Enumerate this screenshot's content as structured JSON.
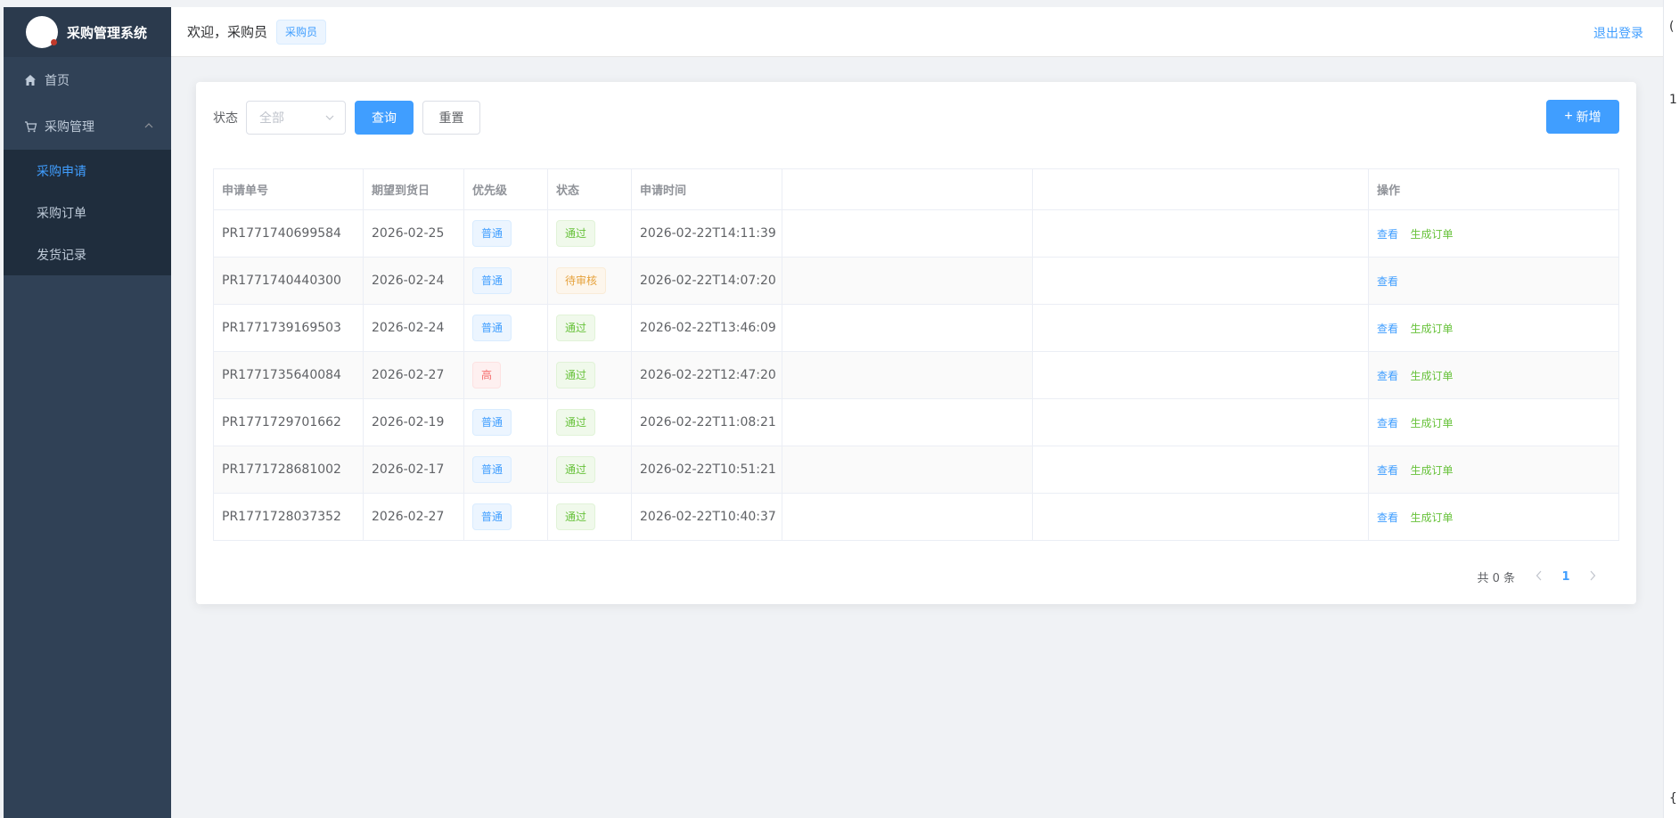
{
  "app": {
    "title": "采购管理系统"
  },
  "sidebar": {
    "items": [
      {
        "label": "首页",
        "icon": "home-icon"
      },
      {
        "label": "采购管理",
        "icon": "cart-icon",
        "expanded": true,
        "children": [
          {
            "label": "采购申请",
            "active": true
          },
          {
            "label": "采购订单"
          },
          {
            "label": "发货记录"
          }
        ]
      }
    ]
  },
  "header": {
    "welcome": "欢迎，采购员",
    "role": "采购员",
    "logout": "退出登录"
  },
  "filter": {
    "status_label": "状态",
    "status_placeholder": "全部",
    "query_label": "查询",
    "reset_label": "重置",
    "add_label": "新增"
  },
  "table": {
    "headers": {
      "request_no": "申请单号",
      "expected_date": "期望到货日",
      "priority": "优先级",
      "status": "状态",
      "request_time": "申请时间",
      "ops": "操作"
    },
    "rows": [
      {
        "request_no": "PR1771740699584",
        "expected_date": "2026-02-25",
        "priority": "普通",
        "status": "通过",
        "request_time": "2026-02-22T14:11:39",
        "view": "查看",
        "gen": "生成订单"
      },
      {
        "request_no": "PR1771740440300",
        "expected_date": "2026-02-24",
        "priority": "普通",
        "status": "待审核",
        "request_time": "2026-02-22T14:07:20",
        "view": "查看",
        "gen": ""
      },
      {
        "request_no": "PR1771739169503",
        "expected_date": "2026-02-24",
        "priority": "普通",
        "status": "通过",
        "request_time": "2026-02-22T13:46:09",
        "view": "查看",
        "gen": "生成订单"
      },
      {
        "request_no": "PR1771735640084",
        "expected_date": "2026-02-27",
        "priority": "高",
        "status": "通过",
        "request_time": "2026-02-22T12:47:20",
        "view": "查看",
        "gen": "生成订单"
      },
      {
        "request_no": "PR1771729701662",
        "expected_date": "2026-02-19",
        "priority": "普通",
        "status": "通过",
        "request_time": "2026-02-22T11:08:21",
        "view": "查看",
        "gen": "生成订单"
      },
      {
        "request_no": "PR1771728681002",
        "expected_date": "2026-02-17",
        "priority": "普通",
        "status": "通过",
        "request_time": "2026-02-22T10:51:21",
        "view": "查看",
        "gen": "生成订单"
      },
      {
        "request_no": "PR1771728037352",
        "expected_date": "2026-02-27",
        "priority": "普通",
        "status": "通过",
        "request_time": "2026-02-22T10:40:37",
        "view": "查看",
        "gen": "生成订单"
      }
    ]
  },
  "pagination": {
    "total_text": "共 0 条",
    "current_page": "1"
  },
  "edge": {
    "top_glyph": "(",
    "mid_glyph": "1",
    "bottom_glyph": "{"
  },
  "colors": {
    "sidebar_bg": "#304156",
    "primary": "#409eff",
    "success": "#67c23a",
    "warning": "#e6a23c",
    "danger": "#f56c6c"
  }
}
